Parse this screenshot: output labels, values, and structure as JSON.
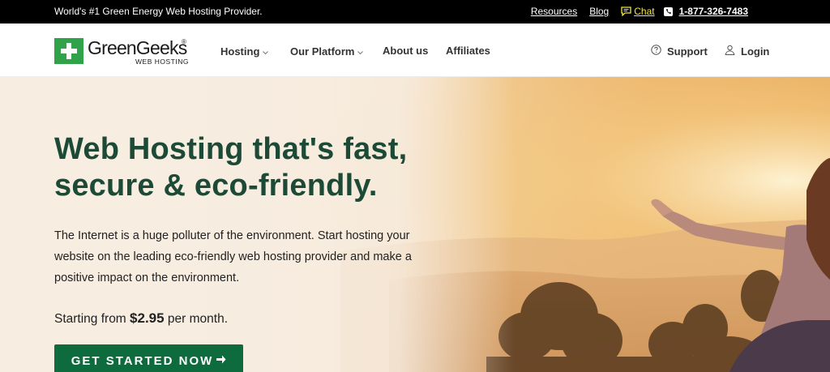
{
  "topbar": {
    "tagline": "World's #1 Green Energy Web Hosting Provider.",
    "resources": "Resources",
    "blog": "Blog",
    "chat": "Chat",
    "phone": "1-877-326-7483"
  },
  "nav": {
    "logo_text": "GreenGeeks",
    "logo_reg": "®",
    "logo_sub": "WEB HOSTING",
    "items": [
      {
        "label": "Hosting",
        "has_dropdown": true
      },
      {
        "label": "Our Platform",
        "has_dropdown": true
      },
      {
        "label": "About us",
        "has_dropdown": false
      },
      {
        "label": "Affiliates",
        "has_dropdown": false
      }
    ],
    "support": "Support",
    "login": "Login"
  },
  "hero": {
    "headline_line1": "Web Hosting that's fast,",
    "headline_line2": "secure & eco-friendly.",
    "lead": "The Internet is a huge polluter of the environment. Start hosting your website on the leading eco-friendly web hosting provider and make a positive impact on the environment.",
    "price_prefix": "Starting from",
    "price": "$2.95",
    "price_suffix": "per month.",
    "cta": "GET STARTED NOW"
  },
  "colors": {
    "brand_green": "#2fa24a",
    "headline_green": "#1d4a37",
    "cta_green": "#0e6b3e",
    "topbar_bg": "#000000",
    "chat_yellow": "#f2e53a"
  }
}
